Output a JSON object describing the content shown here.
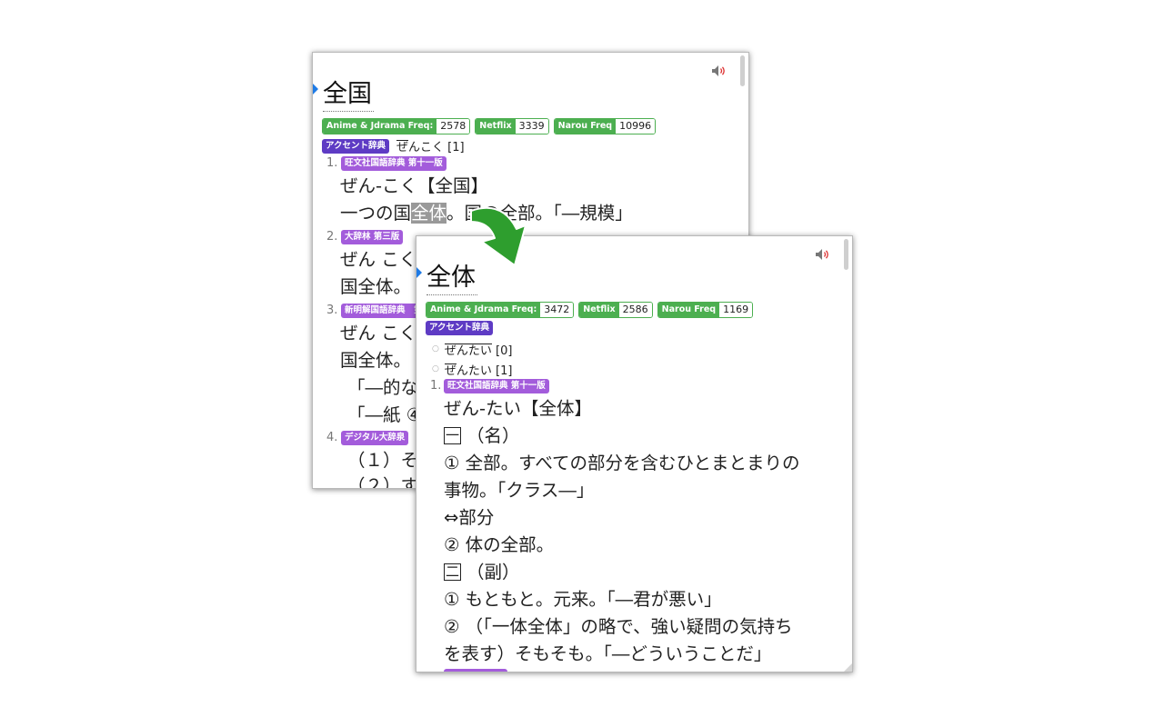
{
  "back_popup": {
    "headword": "全国",
    "freq": [
      {
        "label": "Anime & Jdrama Freq:",
        "value": "2578"
      },
      {
        "label": "Netflix",
        "value": "3339"
      },
      {
        "label": "Narou Freq",
        "value": "10996"
      }
    ],
    "accent_tag": "アクセント辞典",
    "pitch": {
      "over": "ぜ",
      "rest": "んこく [1]"
    },
    "entries": [
      {
        "num": "1.",
        "dict": "旺文社国語辞典 第十一版"
      },
      {
        "num": "2.",
        "dict": "大辞林 第三版"
      },
      {
        "num": "3.",
        "dict": "新明解国語辞典　第"
      },
      {
        "num": "4.",
        "dict": "デジタル大辞泉"
      }
    ],
    "lines": [
      "ぜん-こく【全国】",
      "一つの国",
      "全体",
      "。国の全部。「―規模」",
      "ぜん こく",
      "国全体。",
      "ぜん こく",
      "国全体。",
      "「―的な",
      "「―紙 ④",
      "（１）そ",
      "（２）す"
    ]
  },
  "front_popup": {
    "headword": "全体",
    "freq": [
      {
        "label": "Anime & Jdrama Freq:",
        "value": "3472"
      },
      {
        "label": "Netflix",
        "value": "2586"
      },
      {
        "label": "Narou Freq",
        "value": "1169"
      }
    ],
    "accent_tag": "アクセント辞典",
    "pitches": [
      {
        "over": "ぜんたい",
        "rest": " [0]"
      },
      {
        "over": "ぜ",
        "rest": "んたい [1]"
      }
    ],
    "entry_num": "1.",
    "dict": "旺文社国語辞典 第十一版",
    "box1": "一",
    "box2": "二",
    "lines": [
      "ぜん-たい【全体】",
      "（名）",
      "① 全部。すべての部分を含むひとまとまりの",
      "事物。「クラス―」",
      "⇔部分",
      "② 体の全部。",
      "（副）",
      "① もともと。元来。「―君が悪い」",
      "② （「一体全体」の略で、強い疑問の気持ち",
      "を表す）そもそも。「―どういうことだ」"
    ]
  },
  "colors": {
    "freq": "#4caf50",
    "accent": "#5e3bc4",
    "dict": "#a35cdb",
    "arrow": "#2e9e2e",
    "marker": "#1e7be6"
  }
}
